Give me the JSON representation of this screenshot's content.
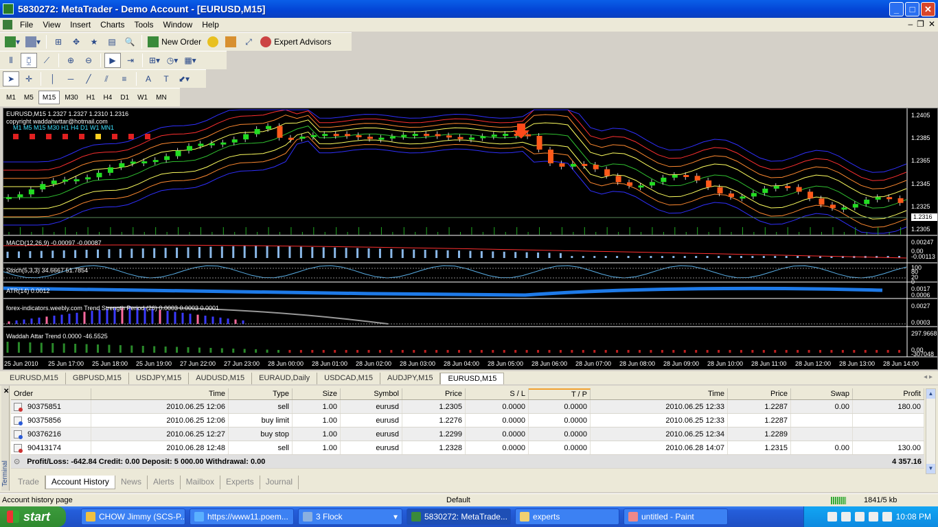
{
  "window": {
    "title": "5830272: MetaTrader - Demo Account - [EURUSD,M15]"
  },
  "menu": [
    "File",
    "View",
    "Insert",
    "Charts",
    "Tools",
    "Window",
    "Help"
  ],
  "toolbar": {
    "new_order": "New Order",
    "expert_advisors": "Expert Advisors"
  },
  "timeframes": [
    "M1",
    "M5",
    "M15",
    "M30",
    "H1",
    "H4",
    "D1",
    "W1",
    "MN"
  ],
  "active_timeframe": "M15",
  "chart": {
    "symbol_line": "EURUSD,M15  1.2327 1.2327 1.2310 1.2316",
    "copyright": "copyright waddahwttar@hotmail.com",
    "tf_row": "M1  M5  M15 M30  H1  H4  D1  W1  MN1",
    "current_price": "1.2316",
    "price_labels": [
      "1.2405",
      "1.2385",
      "1.2365",
      "1.2345",
      "1.2325",
      "1.2305"
    ],
    "indicators": {
      "macd": "MACD(12,26,9) -0.00097 -0.00087",
      "macd_scale": [
        "0.00247",
        "0.00",
        "-0.00113"
      ],
      "stoch": "Stoch(5,3,3) 34.6667 51.7854",
      "stoch_scale": [
        "100",
        "80",
        "20",
        "0"
      ],
      "atr": "ATR(14) 0.0012",
      "atr_scale": [
        "0.0017",
        "0.0006"
      ],
      "trend": "forex-indicators.weebly.com Trend Strength Period (26) 0.0003 0.0003 0.0001",
      "trend_scale": [
        "0.0027",
        "0.0003"
      ],
      "waddah": "Waddah Attar Trend 0.0000 -46.5525",
      "waddah_scale": [
        "297.9668",
        "0.00",
        "-307048"
      ]
    },
    "time_labels": [
      "25 Jun 2010",
      "25 Jun 17:00",
      "25 Jun 18:00",
      "25 Jun 19:00",
      "27 Jun 22:00",
      "27 Jun 23:00",
      "28 Jun 00:00",
      "28 Jun 01:00",
      "28 Jun 02:00",
      "28 Jun 03:00",
      "28 Jun 04:00",
      "28 Jun 05:00",
      "28 Jun 06:00",
      "28 Jun 07:00",
      "28 Jun 08:00",
      "28 Jun 09:00",
      "28 Jun 10:00",
      "28 Jun 11:00",
      "28 Jun 12:00",
      "28 Jun 13:00",
      "28 Jun 14:00"
    ],
    "colors": {
      "bull": "#22dd22",
      "bear": "#ff5a1a",
      "band_red": "#ff3030",
      "band_blue": "#2a2aff",
      "band_orange": "#ff8a30"
    }
  },
  "chart_tabs": [
    "EURUSD,M15",
    "GBPUSD,M15",
    "USDJPY,M15",
    "AUDUSD,M15",
    "EURAUD,Daily",
    "USDCAD,M15",
    "AUDJPY,M15",
    "EURUSD,M15"
  ],
  "active_chart_tab": 7,
  "terminal": {
    "side_label": "Terminal",
    "columns": [
      "Order",
      "Time",
      "Type",
      "Size",
      "Symbol",
      "Price",
      "S / L",
      "T / P",
      "Time",
      "Price",
      "Swap",
      "Profit"
    ],
    "rows": [
      [
        "90375851",
        "2010.06.25 12:06",
        "sell",
        "1.00",
        "eurusd",
        "1.2305",
        "0.0000",
        "0.0000",
        "2010.06.25 12:33",
        "1.2287",
        "0.00",
        "180.00"
      ],
      [
        "90375856",
        "2010.06.25 12:06",
        "buy limit",
        "1.00",
        "eurusd",
        "1.2276",
        "0.0000",
        "0.0000",
        "2010.06.25 12:33",
        "1.2287",
        "",
        ""
      ],
      [
        "90376216",
        "2010.06.25 12:27",
        "buy stop",
        "1.00",
        "eurusd",
        "1.2299",
        "0.0000",
        "0.0000",
        "2010.06.25 12:34",
        "1.2289",
        "",
        ""
      ],
      [
        "90413174",
        "2010.06.28 12:48",
        "sell",
        "1.00",
        "eurusd",
        "1.2328",
        "0.0000",
        "0.0000",
        "2010.06.28 14:07",
        "1.2315",
        "0.00",
        "130.00"
      ]
    ],
    "summary": "Profit/Loss: -642.84  Credit: 0.00  Deposit: 5 000.00  Withdrawal: 0.00",
    "summary_total": "4 357.16",
    "tabs": [
      "Trade",
      "Account History",
      "News",
      "Alerts",
      "Mailbox",
      "Experts",
      "Journal"
    ],
    "active_tab": 1
  },
  "status": {
    "left": "Account history page",
    "profile": "Default",
    "traffic": "1841/5 kb"
  },
  "taskbar": {
    "start": "start",
    "items": [
      "CHOW Jimmy (SCS-P...",
      "https://www11.poem...",
      "3 Flock",
      "5830272: MetaTrade...",
      "experts",
      "untitled - Paint"
    ],
    "active_item": 3,
    "clock": "10:08 PM"
  }
}
